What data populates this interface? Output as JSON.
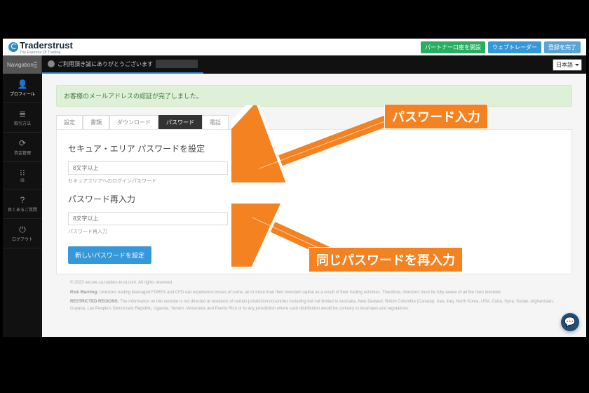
{
  "logo": {
    "brand": "Traderstrust",
    "tagline": "The Essence Of Trading"
  },
  "header_buttons": {
    "partner": "パートナー口座を開設",
    "webtrader": "ウェブトレーダー",
    "complete": "登録を完了"
  },
  "subbar": {
    "nav_label": "Navigation",
    "greeting": "ご利用頂き誠にありがとうございます",
    "language": "日本語"
  },
  "sidebar": {
    "items": [
      {
        "icon": "👤",
        "label": "プロフィール"
      },
      {
        "icon": "≣",
        "label": "取引方法"
      },
      {
        "icon": "⟳",
        "label": "資金管理"
      },
      {
        "icon": "⁝⁝",
        "label": "IB"
      },
      {
        "icon": "?",
        "label": "良くあるご質問"
      },
      {
        "icon": "⏻",
        "label": "ログアウト"
      }
    ]
  },
  "alert": "お客様のメールアドレスの認証が完了しました。",
  "tabs": [
    "設定",
    "書類",
    "ダウンロード",
    "パスワード",
    "電話"
  ],
  "active_tab": "パスワード",
  "section1": {
    "title": "セキュア・エリア パスワードを設定",
    "placeholder": "8文字以上",
    "hint": "セキュアエリアへのログインパスワード"
  },
  "section2": {
    "title": "パスワード再入力",
    "placeholder": "8文字以上",
    "hint": "パスワード再入力"
  },
  "submit": "新しいパスワードを設定",
  "footer": {
    "copyright": "© 2023 secure.ca.traders-trust.com. All rights reserved.",
    "risk_label": "Risk Warning:",
    "risk": "Investors trading leveraged FOREX and CFD can experience losses of some, all or more than their invested capital as a result of their trading activities. Therefore, investors must be fully aware of all the risks involved.",
    "restricted_label": "RESTRICTED REGIONS:",
    "restricted": "The information on this website is not directed at residents of certain jurisdictions/countries including but not limited to Australia, New Zealand, British Columbia (Canada), Iran, Iraq, North Korea, USA, Cuba, Syria, Sudan, Afghanistan, Guyana, Lao People's Democratic Republic, Uganda, Yemen, Venezuela and Puerto Rico or to any jurisdiction where such distribution would be contrary to local laws and regulations."
  },
  "annotations": {
    "a1": "パスワード入力",
    "a2": "同じパスワードを再入力"
  }
}
